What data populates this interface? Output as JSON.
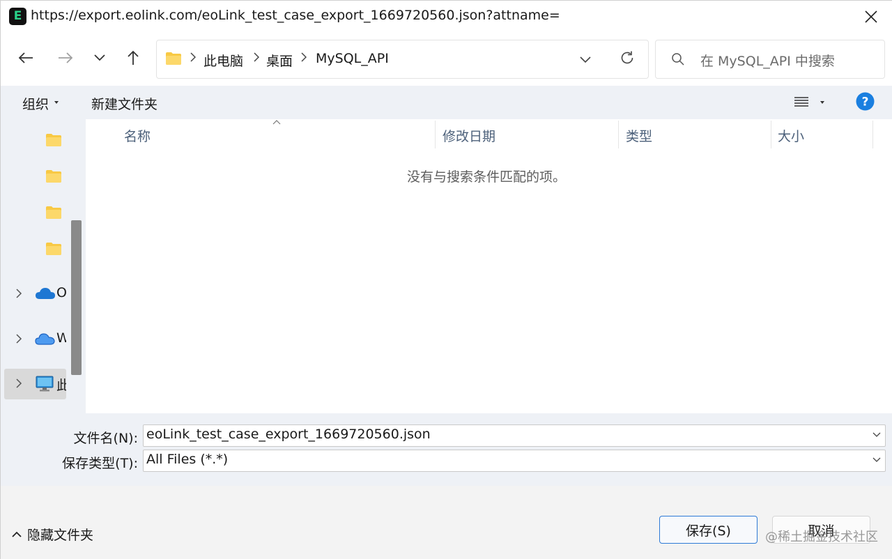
{
  "window": {
    "title": "https://export.eolink.com/eoLink_test_case_export_1669720560.json?attname=",
    "app_icon_glyph": "E"
  },
  "nav": {
    "back_icon": "arrow-left-icon",
    "forward_icon": "arrow-right-icon",
    "recent_icon": "chevron-down-icon",
    "up_icon": "arrow-up-icon",
    "breadcrumbs": [
      "此电脑",
      "桌面",
      "MySQL_API"
    ],
    "refresh_icon": "refresh-icon",
    "search_placeholder": "在 MySQL_API 中搜索"
  },
  "commandbar": {
    "organize": "组织",
    "new_folder": "新建文件夹",
    "view_icon": "list-view-icon",
    "help_icon": "help-icon"
  },
  "sidebar": {
    "items": [
      {
        "type": "folder",
        "label": ""
      },
      {
        "type": "folder",
        "label": ""
      },
      {
        "type": "folder",
        "label": ""
      },
      {
        "type": "folder",
        "label": ""
      },
      {
        "type": "onedrive",
        "label": "O"
      },
      {
        "type": "cloud",
        "label": "W"
      },
      {
        "type": "this-pc",
        "label": "此",
        "selected": true
      }
    ]
  },
  "filelist": {
    "columns": [
      "名称",
      "修改日期",
      "类型",
      "大小"
    ],
    "empty_message": "没有与搜索条件匹配的项。"
  },
  "form": {
    "filename_label": "文件名(N):",
    "filename_value": "eoLink_test_case_export_1669720560.json",
    "filetype_label": "保存类型(T):",
    "filetype_value": "All Files (*.*)"
  },
  "footer": {
    "hide_folders": "隐藏文件夹",
    "save": "保存(S)",
    "cancel": "取消",
    "watermark": "@稀土掘金技术社区"
  },
  "colors": {
    "accent": "#2d7ad6",
    "folder": "#f8c944",
    "help": "#1a7fe0"
  }
}
